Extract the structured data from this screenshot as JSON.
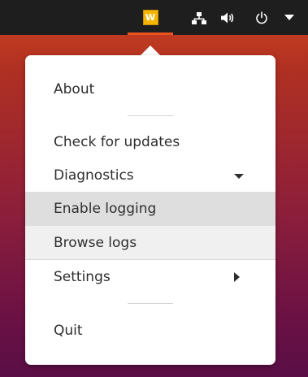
{
  "top_panel": {
    "app_indicator_letter": "W",
    "icons": [
      "app-indicator-icon",
      "network-icon",
      "volume-icon",
      "power-icon",
      "system-menu-arrow-icon"
    ]
  },
  "menu": {
    "items": [
      {
        "label": "About"
      },
      {
        "label": "Check for updates"
      },
      {
        "label": "Diagnostics"
      },
      {
        "label": "Enable logging"
      },
      {
        "label": "Browse logs"
      },
      {
        "label": "Settings"
      },
      {
        "label": "Quit"
      }
    ]
  },
  "colors": {
    "panel": "#1e1e1e",
    "accent": "#e95420",
    "indicator_icon": "#f4b400",
    "menu_bg": "#ffffff",
    "hover_bg": "#dedede"
  }
}
